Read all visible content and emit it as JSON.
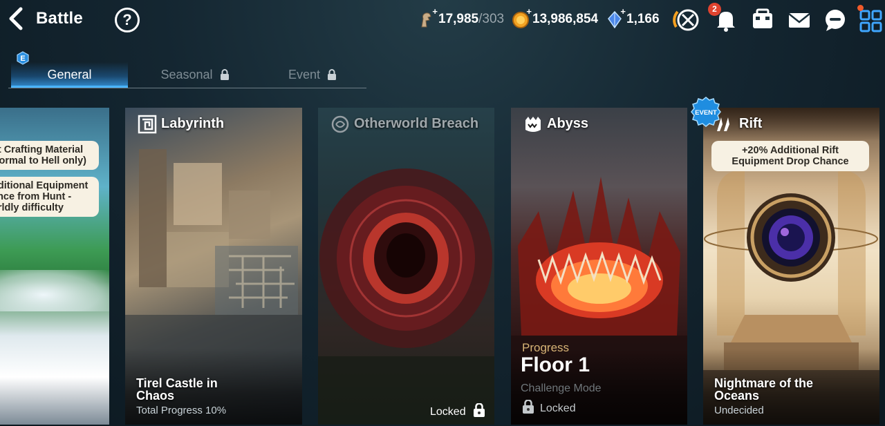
{
  "header": {
    "title": "Battle",
    "help_label": "?",
    "stamina": "17,985",
    "stamina_max": "/303",
    "gold": "13,986,854",
    "crystals": "1,166",
    "notification_count": "2",
    "icons": [
      "back-arrow-icon",
      "help-icon",
      "stamina-icon",
      "gold-icon",
      "crystal-icon",
      "auto-battle-icon",
      "bell-icon",
      "inventory-icon",
      "mail-icon",
      "chat-icon",
      "menu-grid-icon"
    ]
  },
  "tabs": {
    "new_badge": "E",
    "items": [
      {
        "label": "General",
        "active": true
      },
      {
        "label": "Seasonal",
        "locked": true
      },
      {
        "label": "Event",
        "locked": true
      }
    ]
  },
  "cards": {
    "hunt": {
      "note1_line1": "nt Crafting Material",
      "note1_line2": " Normal to Hell only)",
      "note2_line1": "dditional Equipment",
      "note2_line2": "ance from Hunt -",
      "note2_line3": "orldly difficulty"
    },
    "labyrinth": {
      "name": "Labyrinth",
      "stage_line1": "Tirel Castle in",
      "stage_line2": "Chaos",
      "progress": "Total Progress 10%"
    },
    "otherworld": {
      "name": "Otherworld Breach",
      "status": "Locked"
    },
    "abyss": {
      "name": "Abyss",
      "progress_label": "Progress",
      "floor": "Floor 1",
      "mode": "Challenge Mode",
      "status": "Locked"
    },
    "rift": {
      "name": "Rift",
      "event_badge": "EVENT",
      "bonus_line1": "+20% Additional Rift",
      "bonus_line2": "Equipment Drop Chance",
      "stage_line1": "Nightmare of the",
      "stage_line2": "Oceans",
      "status": "Undecided"
    }
  },
  "colors": {
    "accent_blue": "#49b4ff",
    "pill_bg": "#f7f1e3",
    "badge_red": "#e0432f"
  }
}
